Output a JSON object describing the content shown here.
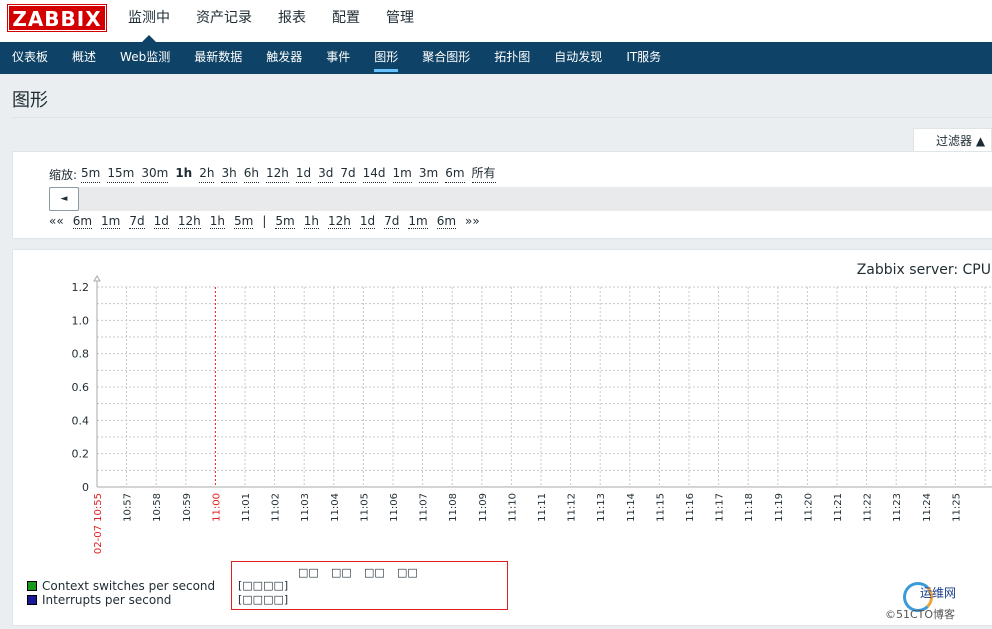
{
  "header": {
    "logo_text": "ZABBIX",
    "menu": [
      {
        "label": "监测中",
        "active": true
      },
      {
        "label": "资产记录",
        "active": false
      },
      {
        "label": "报表",
        "active": false
      },
      {
        "label": "配置",
        "active": false
      },
      {
        "label": "管理",
        "active": false
      }
    ]
  },
  "subnav": {
    "items": [
      {
        "label": "仪表板",
        "active": false
      },
      {
        "label": "概述",
        "active": false
      },
      {
        "label": "Web监测",
        "active": false
      },
      {
        "label": "最新数据",
        "active": false
      },
      {
        "label": "触发器",
        "active": false
      },
      {
        "label": "事件",
        "active": false
      },
      {
        "label": "图形",
        "active": true
      },
      {
        "label": "聚合图形",
        "active": false
      },
      {
        "label": "拓扑图",
        "active": false
      },
      {
        "label": "自动发现",
        "active": false
      },
      {
        "label": "IT服务",
        "active": false
      }
    ]
  },
  "page": {
    "title": "图形"
  },
  "filter": {
    "tab_label": "过滤器 ▲",
    "zoom_label": "缩放:",
    "zoom_options": [
      "5m",
      "15m",
      "30m",
      "1h",
      "2h",
      "3h",
      "6h",
      "12h",
      "1d",
      "3d",
      "7d",
      "14d",
      "1m",
      "3m",
      "6m",
      "所有"
    ],
    "zoom_active": "1h",
    "scroll_left_glyph": "◄",
    "nav_back_glyph": "««",
    "nav_back": [
      "6m",
      "1m",
      "7d",
      "1d",
      "12h",
      "1h",
      "5m"
    ],
    "nav_separator": "|",
    "nav_forward": [
      "5m",
      "1h",
      "12h",
      "1d",
      "7d",
      "1m",
      "6m"
    ],
    "nav_forward_glyph": "»»"
  },
  "chart_data": {
    "type": "line",
    "title": "Zabbix server: CPU",
    "ylim": [
      0,
      1.2
    ],
    "y_ticks": [
      "0",
      "0.2",
      "0.4",
      "0.6",
      "0.8",
      "1.0",
      "1.2"
    ],
    "x_labels": [
      {
        "label": "02-07 10:55",
        "highlight": true
      },
      {
        "label": "10:57",
        "highlight": false
      },
      {
        "label": "10:58",
        "highlight": false
      },
      {
        "label": "10:59",
        "highlight": false
      },
      {
        "label": "11:00",
        "highlight": true
      },
      {
        "label": "11:01",
        "highlight": false
      },
      {
        "label": "11:02",
        "highlight": false
      },
      {
        "label": "11:03",
        "highlight": false
      },
      {
        "label": "11:04",
        "highlight": false
      },
      {
        "label": "11:05",
        "highlight": false
      },
      {
        "label": "11:06",
        "highlight": false
      },
      {
        "label": "11:07",
        "highlight": false
      },
      {
        "label": "11:08",
        "highlight": false
      },
      {
        "label": "11:09",
        "highlight": false
      },
      {
        "label": "11:10",
        "highlight": false
      },
      {
        "label": "11:11",
        "highlight": false
      },
      {
        "label": "11:12",
        "highlight": false
      },
      {
        "label": "11:13",
        "highlight": false
      },
      {
        "label": "11:14",
        "highlight": false
      },
      {
        "label": "11:15",
        "highlight": false
      },
      {
        "label": "11:16",
        "highlight": false
      },
      {
        "label": "11:17",
        "highlight": false
      },
      {
        "label": "11:18",
        "highlight": false
      },
      {
        "label": "11:19",
        "highlight": false
      },
      {
        "label": "11:20",
        "highlight": false
      },
      {
        "label": "11:21",
        "highlight": false
      },
      {
        "label": "11:22",
        "highlight": false
      },
      {
        "label": "11:23",
        "highlight": false
      },
      {
        "label": "11:24",
        "highlight": false
      },
      {
        "label": "11:25",
        "highlight": false
      }
    ],
    "series": [
      {
        "name": "Context switches per second",
        "color": "#1a9a1a",
        "values": []
      },
      {
        "name": "Interrupts per second",
        "color": "#1a1a99",
        "values": []
      }
    ],
    "grid": true,
    "highlight_color": "#e02020"
  },
  "stats": {
    "headers": [
      "□□",
      "□□",
      "□□",
      "□□"
    ],
    "rows": [
      "[□□□□]",
      "[□□□□]"
    ]
  },
  "watermark": {
    "text": "运维网",
    "sub": "©51CTO博客"
  }
}
